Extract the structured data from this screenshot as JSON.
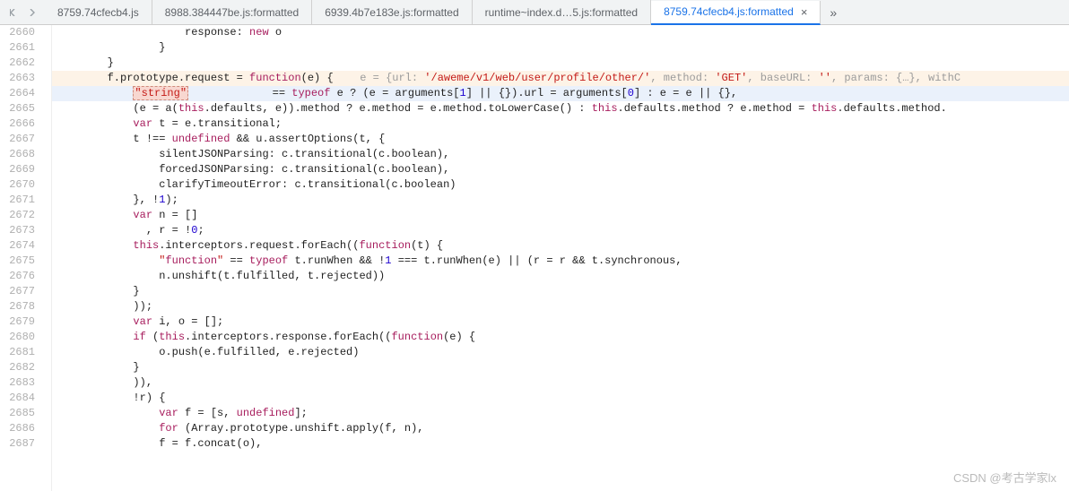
{
  "tabs": [
    {
      "label": "8759.74cfecb4.js",
      "active": false
    },
    {
      "label": "8988.384447be.js:formatted",
      "active": false
    },
    {
      "label": "6939.4b7e183e.js:formatted",
      "active": false
    },
    {
      "label": "runtime~index.d…5.js:formatted",
      "active": false
    },
    {
      "label": "8759.74cfecb4.js:formatted",
      "active": true,
      "closable": true
    }
  ],
  "overflow_glyph": "»",
  "close_glyph": "×",
  "line_numbers": [
    "2660",
    "2661",
    "2662",
    "2663",
    "2664",
    "2665",
    "2666",
    "2667",
    "2668",
    "2669",
    "2670",
    "2671",
    "2672",
    "2673",
    "2674",
    "2675",
    "2676",
    "2677",
    "2678",
    "2679",
    "2680",
    "2681",
    "2682",
    "2683",
    "2684",
    "2685",
    "2686",
    "2687",
    ""
  ],
  "code": {
    "l2660": "                    response: new o",
    "l2661": "                }",
    "l2662": "        }",
    "l2663_pre": "        f.prototype.request = function(e) {",
    "l2663_hint": "   e = {url: '/aweme/v1/web/user/profile/other/', method: 'GET', baseURL: '', params: {…}, withC",
    "l2664": "             == typeof e ? (e = arguments[1] || {}).url = arguments[0] : e = e || {},",
    "l2664_box": "\"string\"",
    "l2665": "            (e = a(this.defaults, e)).method ? e.method = e.method.toLowerCase() : this.defaults.method ? e.method = this.defaults.method.",
    "l2666": "            var t = e.transitional;",
    "l2667": "            t !== undefined && u.assertOptions(t, {",
    "l2668": "                silentJSONParsing: c.transitional(c.boolean),",
    "l2669": "                forcedJSONParsing: c.transitional(c.boolean),",
    "l2670": "                clarifyTimeoutError: c.transitional(c.boolean)",
    "l2671": "            }, !1);",
    "l2672": "            var n = []",
    "l2673": "              , r = !0;",
    "l2674": "            this.interceptors.request.forEach((function(t) {",
    "l2675": "                \"function\" == typeof t.runWhen && !1 === t.runWhen(e) || (r = r && t.synchronous,",
    "l2676": "                n.unshift(t.fulfilled, t.rejected))",
    "l2677": "            }",
    "l2678": "            ));",
    "l2679": "            var i, o = [];",
    "l2680": "            if (this.interceptors.response.forEach((function(e) {",
    "l2681": "                o.push(e.fulfilled, e.rejected)",
    "l2682": "            }",
    "l2683": "            )),",
    "l2684": "            !r) {",
    "l2685": "                var f = [s, undefined];",
    "l2686": "                for (Array.prototype.unshift.apply(f, n),",
    "l2687": "                f = f.concat(o),"
  },
  "watermark": "CSDN @考古学家lx"
}
